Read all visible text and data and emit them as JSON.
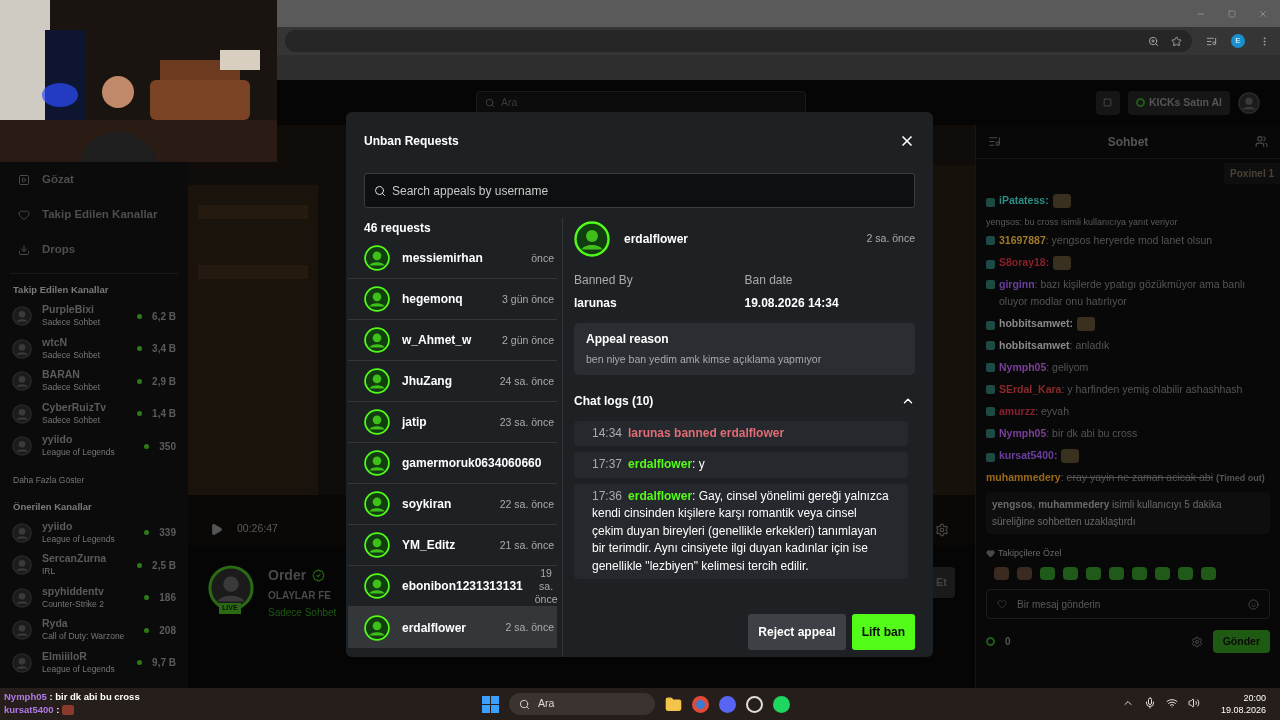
{
  "browser": {
    "profile_initial": "E"
  },
  "site_header": {
    "search_placeholder": "Ara",
    "kicks_button": "KICKs Satın Al"
  },
  "sidebar": {
    "nav": [
      {
        "label": "Gözat",
        "kind": "browse"
      },
      {
        "label": "Takip Edilen Kanallar",
        "kind": "following"
      },
      {
        "label": "Drops",
        "kind": "drops"
      }
    ],
    "followed_title": "Takip Edilen Kanallar",
    "followed": [
      {
        "name": "PurpleBixi",
        "subtitle": "Sadece Sohbet",
        "viewers": "6,2 B"
      },
      {
        "name": "wtcN",
        "subtitle": "Sadece Sohbet",
        "viewers": "3,4 B"
      },
      {
        "name": "BARAN",
        "subtitle": "Sadece Sohbet",
        "viewers": "2,9 B"
      },
      {
        "name": "CyberRuizTv",
        "subtitle": "Sadece Sohbet",
        "viewers": "1,4 B"
      },
      {
        "name": "yyiido",
        "subtitle": "League of Legends",
        "viewers": "350"
      }
    ],
    "show_more": "Daha Fazla Göster",
    "recommended_title": "Önerilen Kanallar",
    "recommended": [
      {
        "name": "yyiido",
        "subtitle": "League of Legends",
        "viewers": "339"
      },
      {
        "name": "SercanZurna",
        "subtitle": "IRL",
        "viewers": "2,5 B"
      },
      {
        "name": "spyhiddentv",
        "subtitle": "Counter-Strike 2",
        "viewers": "186"
      },
      {
        "name": "Ryda",
        "subtitle": "Call of Duty: Warzone",
        "viewers": "208"
      },
      {
        "name": "ElmiiiloR",
        "subtitle": "League of Legends",
        "viewers": "9,7 B"
      }
    ]
  },
  "stream": {
    "time": "00:26:47",
    "channel": "Order",
    "title": "OLAYLAR FE",
    "category": "Sadece Sohbet",
    "live_badge": "LIVE",
    "follow_button": "Et"
  },
  "chat": {
    "title": "Sohbet",
    "pinned": "Poxinel 1",
    "separator": ":",
    "messages": [
      {
        "kind": "emote",
        "user": "iPatatess",
        "color": "#2a8f86"
      },
      {
        "kind": "reply_note",
        "text": "yengsos: bu cross isimli kullanıcıya yanıt veriyor"
      },
      {
        "kind": "text",
        "user": "31697887",
        "color": "#a07a2a",
        "text": "yengsos heryerde mod lanet olsun"
      },
      {
        "kind": "emote",
        "user": "S8oray18",
        "color": "#8a1f2a"
      },
      {
        "kind": "text",
        "user": "girginn",
        "color": "#6a3fa0",
        "text": "bazı kişilerde ypatıgı gözükmüyor ama banlı oluyor modlar onu hatırlıyor"
      },
      {
        "kind": "emote",
        "user": "hobbitsamwet",
        "color": "#8a8a8a"
      },
      {
        "kind": "text",
        "user": "hobbitsamwet",
        "color": "#8a8a8a",
        "text": "anladık"
      },
      {
        "kind": "text",
        "user": "Nymph05",
        "color": "#7a3f9a",
        "text": "geliyom"
      },
      {
        "kind": "text",
        "user": "SErdal_Kara",
        "color": "#8a2a2a",
        "text": "y harfinden yemiş olabilir ashashhash"
      },
      {
        "kind": "text",
        "user": "amurzz",
        "color": "#8a2030",
        "text": "eyvah"
      },
      {
        "kind": "text",
        "user": "Nymph05",
        "color": "#7a3f9a",
        "text": "bir dk abi bu cross"
      },
      {
        "kind": "emote",
        "user": "kursat5400",
        "color": "#6a3fa0"
      },
      {
        "kind": "deleted",
        "user": "muhammedery",
        "color": "#9a6a1a",
        "text": "eray yayin ne zaman acicak abi",
        "note": "(Timed out)"
      }
    ],
    "system_message": "**yengsos**, **muhammedery** isimli kullanıcıyı 5 dakika süreliğine sohbetten uzaklaştırdı",
    "emote_section": "Takipçilere Özel",
    "input_placeholder": "Bir mesaj gönderin",
    "points": "0",
    "send_button": "Gönder"
  },
  "modal": {
    "title": "Unban Requests",
    "search_placeholder": "Search appeals by username",
    "count": "46 requests",
    "requests": [
      {
        "name": "messiemirhan",
        "time": "önce",
        "selected": false
      },
      {
        "name": "hegemonq",
        "time": "3 gün önce",
        "selected": false
      },
      {
        "name": "w_Ahmet_w",
        "time": "2 gün önce",
        "selected": false
      },
      {
        "name": "JhuZang",
        "time": "24 sa. önce",
        "selected": false
      },
      {
        "name": "jatip",
        "time": "23 sa. önce",
        "selected": false
      },
      {
        "name": "gamermoruk0634060660",
        "selected": false
      },
      {
        "name": "soykiran",
        "time": "22 sa. önce",
        "selected": false
      },
      {
        "name": "YM_Editz",
        "time": "21 sa. önce",
        "selected": false
      },
      {
        "name": "ebonibon1231313131",
        "time": "19 sa. önce",
        "selected": false
      },
      {
        "name": "erdalflower",
        "time": "2 sa. önce",
        "selected": true
      }
    ],
    "detail": {
      "user": "erdalflower",
      "time": "2 sa. önce",
      "banned_by_label": "Banned By",
      "banned_by": "larunas",
      "ban_date_label": "Ban date",
      "ban_date": "19.08.2026 14:34",
      "appeal_title": "Appeal reason",
      "appeal_text": "ben niye ban yedim amk kimse açıklama yapmıyor",
      "chat_logs_title": "Chat logs (10)",
      "chat_logs_expanded": true,
      "separator": ":",
      "logs": [
        {
          "kind": "ban",
          "time": "14:34",
          "text": "larunas banned erdalflower"
        },
        {
          "kind": "message",
          "time": "17:37",
          "user": "erdalflower",
          "text": "y"
        },
        {
          "kind": "message",
          "time": "17:36",
          "user": "erdalflower",
          "text": "Gay, cinsel yönelimi gereği yalnızca kendi cinsinden kişilere karşı romantik veya cinsel çekim duyan bireyleri (genellikle erkekleri) tanımlayan bir terimdir. Aynı cinsiyete ilgi duyan kadınlar için ise genellikle \"lezbiyen\" kelimesi tercih edilir."
        }
      ]
    },
    "buttons": [
      {
        "label": "Reject appeal",
        "kind": "secondary"
      },
      {
        "label": "Lift ban",
        "kind": "primary"
      }
    ]
  },
  "overlay_chat": {
    "separator": ":",
    "lines": [
      {
        "kind": "text",
        "user": "Nymph05",
        "text": "bir dk abi bu cross"
      },
      {
        "kind": "emote",
        "user": "kursat5400"
      }
    ]
  },
  "taskbar": {
    "search_placeholder": "Ara",
    "time": "20:00",
    "date": "19.08.2026"
  }
}
